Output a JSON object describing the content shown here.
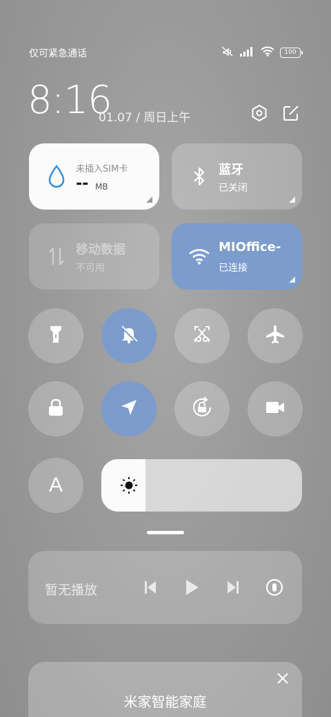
{
  "status_bar": {
    "carrier_text": "仅可紧急通话",
    "battery_level": "100",
    "icons": [
      "mute-icon",
      "signal-icon",
      "wifi-icon",
      "battery-icon"
    ]
  },
  "header": {
    "time": "8:16",
    "date": "01.07 / 周日上午",
    "icons": [
      "settings-icon",
      "edit-icon"
    ]
  },
  "tiles": {
    "data_usage": {
      "title": "未插入SIM卡",
      "value": "--",
      "unit": "MB",
      "icon": "water-drop-icon"
    },
    "bluetooth": {
      "title": "蓝牙",
      "sub": "已关闭",
      "icon": "bluetooth-icon"
    },
    "mobile_data": {
      "title": "移动数据",
      "sub": "不可用",
      "icon": "mobile-data-icon"
    },
    "wifi": {
      "title": "MIOffice-",
      "sub": "已连接",
      "icon": "wifi-icon"
    }
  },
  "toggles_row1": [
    {
      "name": "flashlight",
      "icon": "flashlight-icon",
      "on": false
    },
    {
      "name": "silent",
      "icon": "bell-off-icon",
      "on": true
    },
    {
      "name": "screenshot",
      "icon": "scissors-icon",
      "on": false
    },
    {
      "name": "airplane",
      "icon": "airplane-icon",
      "on": false
    }
  ],
  "toggles_row2": [
    {
      "name": "lock-screen",
      "icon": "lock-icon",
      "on": false
    },
    {
      "name": "location",
      "icon": "location-icon",
      "on": true
    },
    {
      "name": "rotation-lock",
      "icon": "rotate-lock-icon",
      "on": false
    },
    {
      "name": "screen-record",
      "icon": "video-icon",
      "on": false
    }
  ],
  "display": {
    "auto_brightness_label": "A",
    "brightness_level": 0.22
  },
  "media": {
    "title": "暂无播放",
    "icons": [
      "previous-icon",
      "play-icon",
      "next-icon",
      "cast-icon"
    ]
  },
  "smart_home": {
    "title": "米家智能家庭"
  },
  "colors": {
    "accent_blue": "#7b9ccc",
    "tile_white": "#fbfbfb"
  }
}
